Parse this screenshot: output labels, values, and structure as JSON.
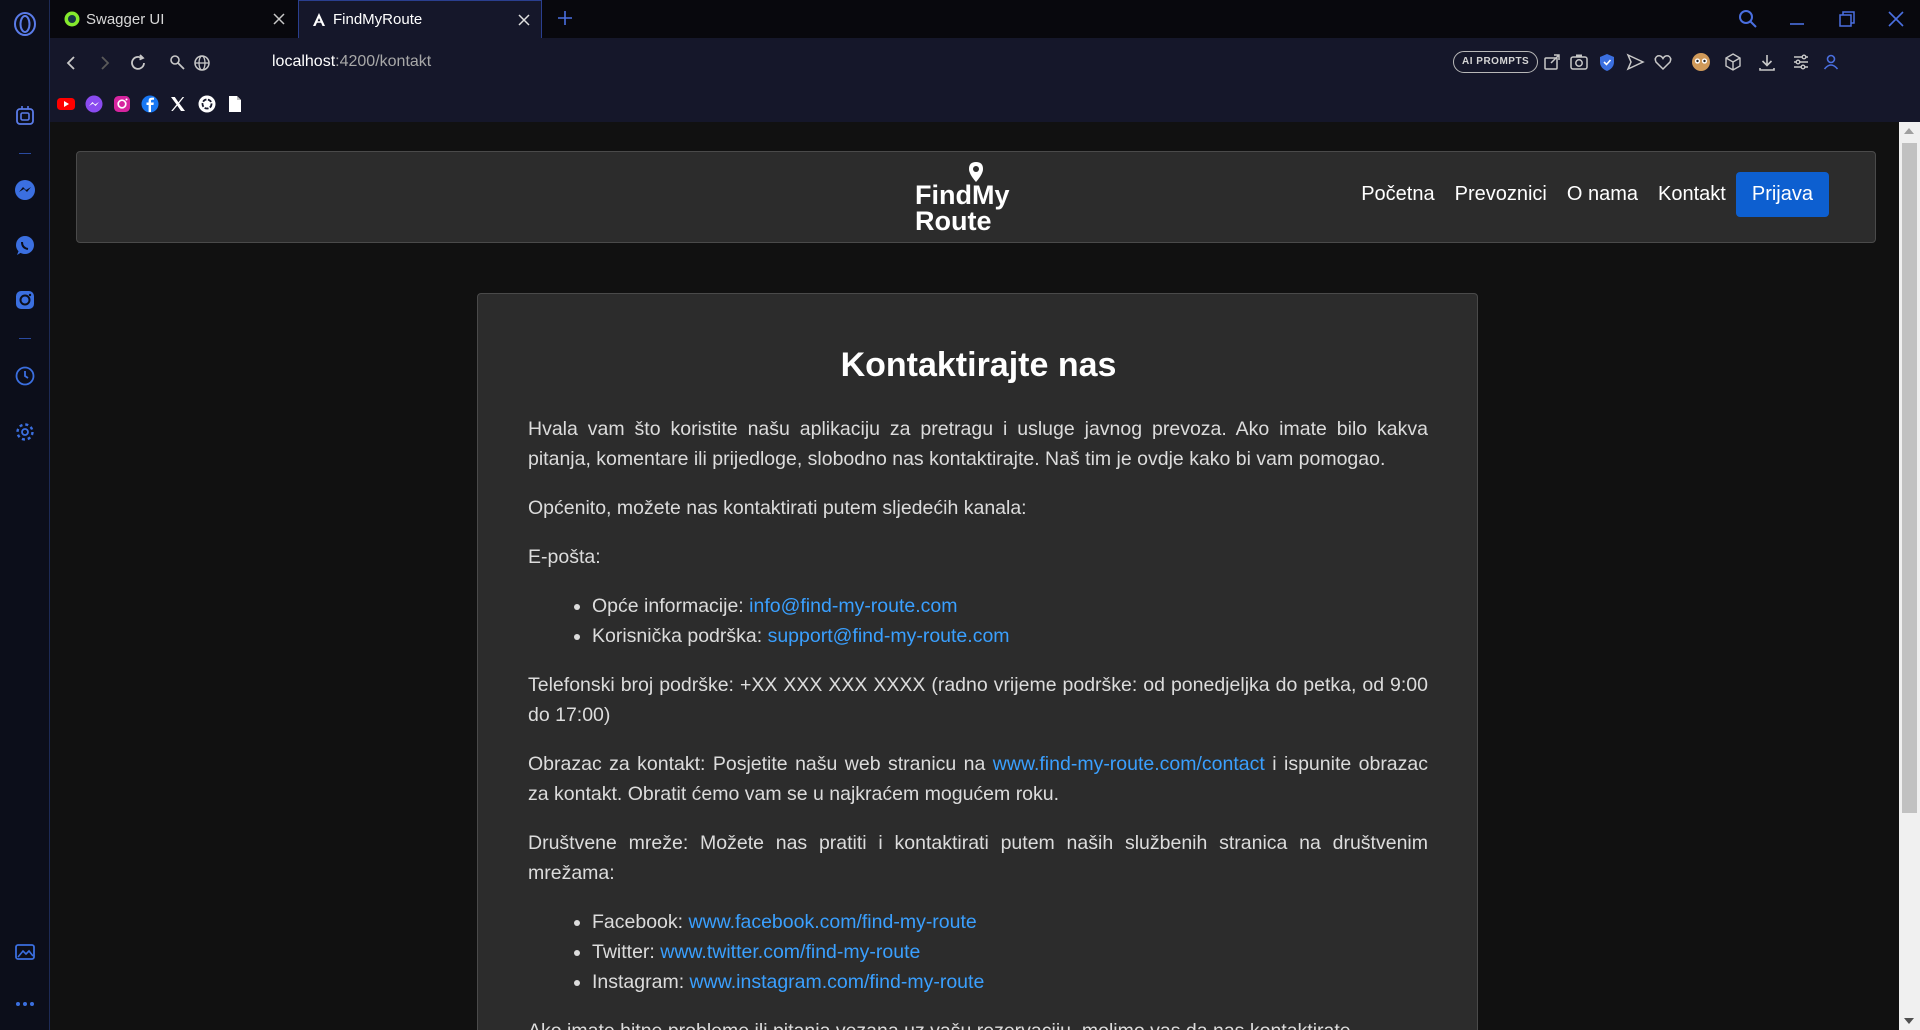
{
  "browser": {
    "tabs": [
      {
        "title": "Swagger UI",
        "active": false
      },
      {
        "title": "FindMyRoute",
        "active": true
      }
    ],
    "url_host": "localhost",
    "url_path": ":4200/kontakt",
    "ai_prompts_label": "AI PROMPTS",
    "sidebar_icons": [
      "opera-logo-icon",
      "aria-icon",
      "messenger-icon",
      "whatsapp-icon",
      "instagram-icon",
      "history-icon",
      "settings-icon",
      "gallery-icon",
      "more-icon"
    ],
    "bookmarks": [
      "youtube-icon",
      "messenger-icon",
      "instagram-icon",
      "facebook-icon",
      "x-icon",
      "chatgpt-icon",
      "document-icon"
    ]
  },
  "navbar": {
    "logo_line1": "FindMy",
    "logo_line2": "Route",
    "links": [
      "Početna",
      "Prevoznici",
      "O nama",
      "Kontakt"
    ],
    "login_label": "Prijava"
  },
  "contact": {
    "title": "Kontaktirajte nas",
    "intro": "Hvala vam što koristite našu aplikaciju za pretragu i usluge javnog prevoza. Ako imate bilo kakva pitanja, komentare ili prijedloge, slobodno nas kontaktirajte. Naš tim je ovdje kako bi vam pomogao.",
    "channels_intro": "Općenito, možete nas kontaktirati putem sljedećih kanala:",
    "email_label": "E-pošta:",
    "emails": [
      {
        "label": "Opće informacije: ",
        "link": "info@find-my-route.com"
      },
      {
        "label": "Korisnička podrška: ",
        "link": "support@find-my-route.com"
      }
    ],
    "phone": "Telefonski broj podrške: +XX XXX XXX XXXX (radno vrijeme podrške: od ponedjeljka do petka, od 9:00 do 17:00)",
    "form_before": "Obrazac za kontakt: Posjetite našu web stranicu na ",
    "form_link": "www.find-my-route.com/contact",
    "form_after": " i ispunite obrazac za kontakt. Obratit ćemo vam se u najkraćem mogućem roku.",
    "social_intro": "Društvene mreže: Možete nas pratiti i kontaktirati putem naših službenih stranica na društvenim mrežama:",
    "socials": [
      {
        "label": "Facebook: ",
        "link": "www.facebook.com/find-my-route"
      },
      {
        "label": "Twitter: ",
        "link": "www.twitter.com/find-my-route"
      },
      {
        "label": "Instagram: ",
        "link": "www.instagram.com/find-my-route"
      }
    ],
    "urgent": "Ako imate hitne probleme ili pitanja vezana uz vašu rezervaciju, molimo vas da nas kontaktirate"
  }
}
